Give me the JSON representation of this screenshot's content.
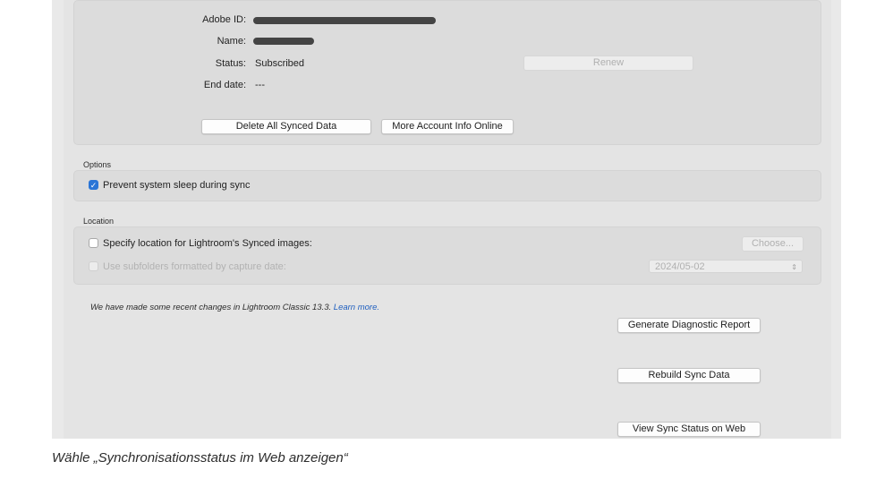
{
  "account": {
    "adobe_id_label": "Adobe ID:",
    "name_label": "Name:",
    "status_label": "Status:",
    "status_value": "Subscribed",
    "end_date_label": "End date:",
    "end_date_value": "---",
    "renew_label": "Renew",
    "delete_label": "Delete All Synced Data",
    "more_info_label": "More Account Info Online"
  },
  "options": {
    "section_label": "Options",
    "prevent_sleep_label": "Prevent system sleep during sync",
    "prevent_sleep_checked": true
  },
  "location": {
    "section_label": "Location",
    "specify_label": "Specify location for Lightroom's Synced images:",
    "choose_label": "Choose...",
    "subfolders_label": "Use subfolders formatted by capture date:",
    "date_format_value": "2024/05-02"
  },
  "notice": {
    "text": "We have made some recent changes in Lightroom Classic 13.3.",
    "link": "Learn more."
  },
  "actions": {
    "diagnostic_label": "Generate Diagnostic Report",
    "rebuild_label": "Rebuild Sync Data",
    "view_status_label": "View Sync Status on Web"
  },
  "caption": "Wähle „Synchronisationsstatus im Web anzeigen“",
  "colors": {
    "accent": "#2a75d6",
    "link": "#1f5fbf",
    "panel": "#dcdcdc"
  }
}
